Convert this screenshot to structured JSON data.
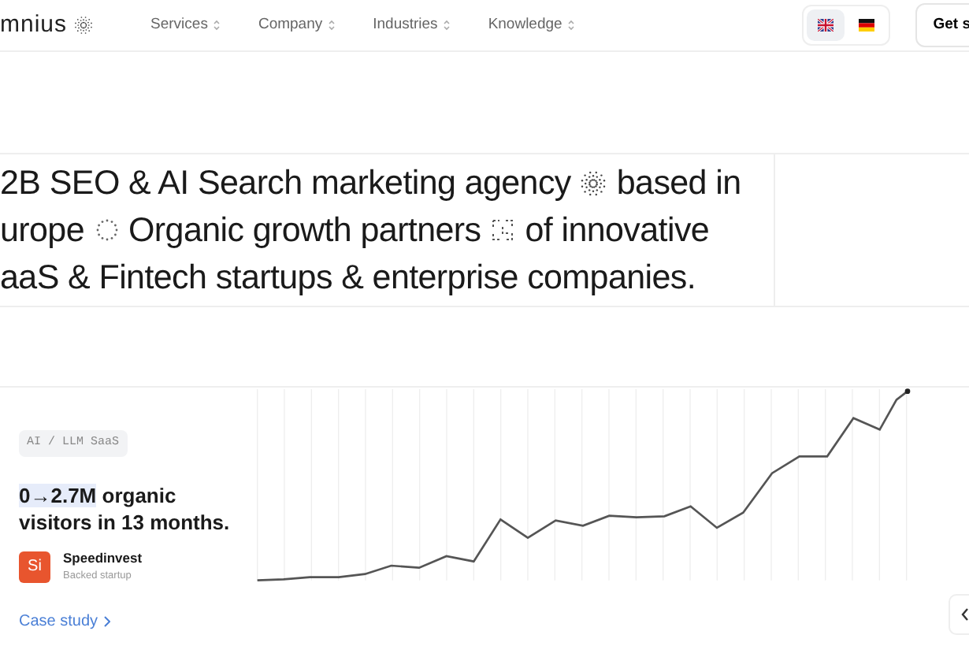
{
  "navbar": {
    "brand": "mnius",
    "items": [
      {
        "label": "Services"
      },
      {
        "label": "Company"
      },
      {
        "label": "Industries"
      },
      {
        "label": "Knowledge"
      }
    ],
    "languages": [
      {
        "kind": "uk",
        "selected": true
      },
      {
        "kind": "de",
        "selected": false
      }
    ],
    "cta": "Get s"
  },
  "headline": {
    "lines": [
      [
        "2B SEO & AI Search marketing agency",
        "based in"
      ],
      [
        "urope",
        "Organic growth partners",
        "of innovative"
      ],
      [
        "aaS & Fintech startups & enterprise companies."
      ]
    ]
  },
  "case": {
    "tag": "AI / LLM SaaS",
    "metric_highlight": "0→2.7M",
    "metric_rest": " organic visitors in 13 months.",
    "company": {
      "logo": "Si",
      "name": "Speedinvest",
      "subtitle": "Backed startup"
    },
    "link": "Case study"
  }
}
